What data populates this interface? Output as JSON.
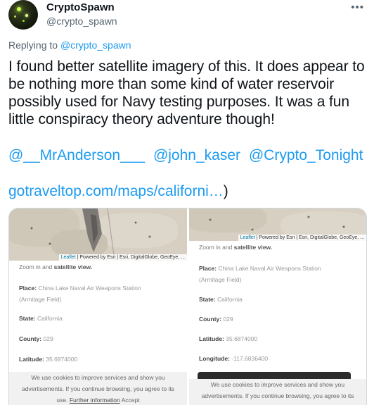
{
  "tweet": {
    "display_name": "CryptoSpawn",
    "handle": "@crypto_spawn",
    "more_icon": "•••",
    "replying_to_prefix": "Replying to",
    "replying_to_handle": "@crypto_spawn",
    "text": "I found better satellite imagery of this. It does appear to be nothing more than some kind of water reservoir possibly used for Navy testing purposes. It was a fun little conspiracy theory adventure though!",
    "mentions": [
      "@__MrAnderson___",
      "@john_kaser",
      "@Crypto_Tonight"
    ],
    "link_text": "gotraveltop.com/maps/californi…",
    "link_suffix": ")"
  },
  "media": {
    "left": {
      "attribution_leaflet": "Leaflet",
      "attribution_rest": " | Powered by Esri | Esri, DigitalGlobe, GeoEye, ...",
      "zoom_hint_prefix": "Zoom in and ",
      "zoom_hint_bold": "satellite view.",
      "place_label": "Place:",
      "place_value": "China Lake Naval Air Weapons Station",
      "place_value_2": "(Armitage Field)",
      "state_label": "State:",
      "state_value": "California",
      "county_label": "County:",
      "county_value": "029",
      "latitude_label": "Latitude:",
      "latitude_value": "35.6874000",
      "cookie_line1": "We use cookies to improve services and show you",
      "cookie_line2": "advertisements. If you continue browsing, you agree to its",
      "cookie_line3_prefix": "use.",
      "cookie_further": "Further information",
      "cookie_accept": "Accept"
    },
    "right": {
      "attribution_leaflet": "Leaflet",
      "attribution_rest": " | Powered by Esri | Esri, DigitalGlobe, GeoEye, ...",
      "zoom_hint_prefix": "Zoom in and ",
      "zoom_hint_bold": "satellite view.",
      "place_label": "Place:",
      "place_value": "China Lake Naval Air Weapons Station",
      "place_value_2": "(Armitage Field)",
      "state_label": "State:",
      "state_value": "California",
      "county_label": "County:",
      "county_value": "029",
      "latitude_label": "Latitude:",
      "latitude_value": "35.6874000",
      "longitude_label": "Longitude:",
      "longitude_value": "-117.6836400",
      "cookie_line1": "We use cookies to improve services and show you",
      "cookie_line2": "advertisements. If you continue browsing, you agree to its"
    }
  },
  "colors": {
    "link_blue": "#1d9bf0",
    "text_primary": "#0f1419",
    "text_secondary": "#536471"
  }
}
